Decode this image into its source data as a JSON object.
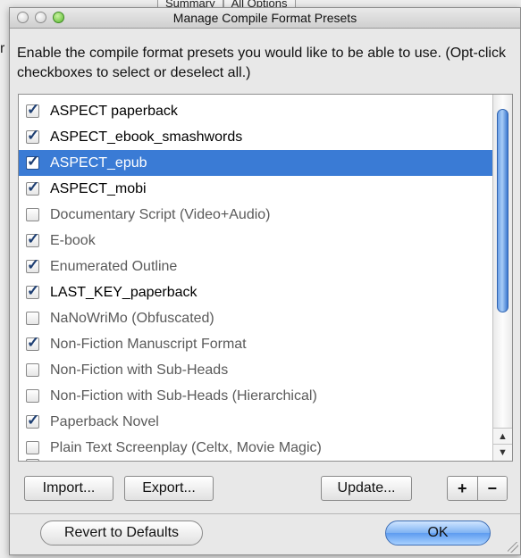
{
  "background": {
    "tabs": [
      "Summary",
      "All Options"
    ],
    "left_char": "r"
  },
  "window": {
    "title": "Manage Compile Format Presets"
  },
  "instructions": "Enable the compile format presets you would like to be able to use. (Opt-click checkboxes to select or deselect all.)",
  "presets": [
    {
      "label": "ASPECT paperback",
      "checked": true,
      "bold": true,
      "selected": false
    },
    {
      "label": "ASPECT_ebook_smashwords",
      "checked": true,
      "bold": true,
      "selected": false
    },
    {
      "label": "ASPECT_epub",
      "checked": true,
      "bold": true,
      "selected": true
    },
    {
      "label": "ASPECT_mobi",
      "checked": true,
      "bold": true,
      "selected": false
    },
    {
      "label": "Documentary Script (Video+Audio)",
      "checked": false,
      "bold": false,
      "selected": false
    },
    {
      "label": "E-book",
      "checked": true,
      "bold": false,
      "selected": false
    },
    {
      "label": "Enumerated Outline",
      "checked": true,
      "bold": false,
      "selected": false
    },
    {
      "label": "LAST_KEY_paperback",
      "checked": true,
      "bold": true,
      "selected": false
    },
    {
      "label": "NaNoWriMo (Obfuscated)",
      "checked": false,
      "bold": false,
      "selected": false
    },
    {
      "label": "Non-Fiction Manuscript Format",
      "checked": true,
      "bold": false,
      "selected": false
    },
    {
      "label": "Non-Fiction with Sub-Heads",
      "checked": false,
      "bold": false,
      "selected": false
    },
    {
      "label": "Non-Fiction with Sub-Heads (Hierarchical)",
      "checked": false,
      "bold": false,
      "selected": false
    },
    {
      "label": "Paperback Novel",
      "checked": true,
      "bold": false,
      "selected": false
    },
    {
      "label": "Plain Text Screenplay (Celtx, Movie Magic)",
      "checked": false,
      "bold": false,
      "selected": false
    }
  ],
  "scroll": {
    "up_arrow": "▲",
    "down_arrow": "▼"
  },
  "buttons": {
    "import": "Import...",
    "export": "Export...",
    "update": "Update...",
    "plus": "+",
    "minus": "−",
    "revert": "Revert to Defaults",
    "ok": "OK"
  }
}
